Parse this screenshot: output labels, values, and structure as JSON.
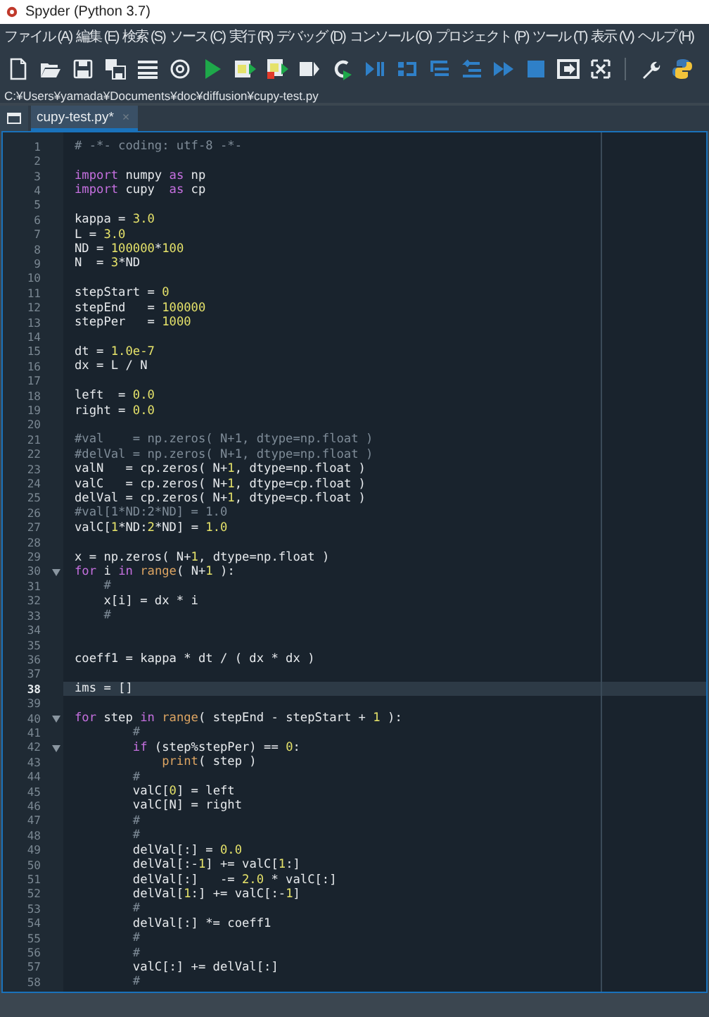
{
  "window": {
    "title": "Spyder (Python 3.7)"
  },
  "menu": [
    "ファイル (A)",
    "編集 (E)",
    "検索 (S)",
    "ソース (C)",
    "実行 (R)",
    "デバッグ (D)",
    "コンソール (O)",
    "プロジェクト (P)",
    "ツール (T)",
    "表示 (V)",
    "ヘルプ (H)"
  ],
  "path": "C:¥Users¥yamada¥Documents¥doc¥diffusion¥cupy-test.py",
  "tabs": [
    {
      "label": "cupy-test.py*",
      "selected": true,
      "close": "×"
    }
  ],
  "editor": {
    "lines": [
      {
        "number": "1",
        "fold": false,
        "current": false,
        "tokens": [
          {
            "text": "# -*- coding: utf-8 -*-",
            "kind": "comment"
          }
        ]
      },
      {
        "number": "2",
        "fold": false,
        "current": false
      },
      {
        "number": "3",
        "fold": false,
        "current": false,
        "tokens": [
          {
            "text": "import",
            "kind": "keyword"
          },
          {
            "text": " numpy ",
            "kind": "plain"
          },
          {
            "text": "as",
            "kind": "keyword"
          },
          {
            "text": " np",
            "kind": "plain"
          }
        ]
      },
      {
        "number": "4",
        "fold": false,
        "current": false,
        "tokens": [
          {
            "text": "import",
            "kind": "keyword"
          },
          {
            "text": " cupy  ",
            "kind": "plain"
          },
          {
            "text": "as",
            "kind": "keyword"
          },
          {
            "text": " cp",
            "kind": "plain"
          }
        ]
      },
      {
        "number": "5",
        "fold": false,
        "current": false
      },
      {
        "number": "6",
        "fold": false,
        "current": false,
        "tokens": [
          {
            "text": "kappa = ",
            "kind": "plain"
          },
          {
            "text": "3.0",
            "kind": "number"
          }
        ]
      },
      {
        "number": "7",
        "fold": false,
        "current": false,
        "tokens": [
          {
            "text": "L = ",
            "kind": "plain"
          },
          {
            "text": "3.0",
            "kind": "number"
          }
        ]
      },
      {
        "number": "8",
        "fold": false,
        "current": false,
        "tokens": [
          {
            "text": "ND = ",
            "kind": "plain"
          },
          {
            "text": "100000",
            "kind": "number"
          },
          {
            "text": "*",
            "kind": "plain"
          },
          {
            "text": "100",
            "kind": "number"
          }
        ]
      },
      {
        "number": "9",
        "fold": false,
        "current": false,
        "tokens": [
          {
            "text": "N  = ",
            "kind": "plain"
          },
          {
            "text": "3",
            "kind": "number"
          },
          {
            "text": "*ND",
            "kind": "plain"
          }
        ]
      },
      {
        "number": "10",
        "fold": false,
        "current": false
      },
      {
        "number": "11",
        "fold": false,
        "current": false,
        "tokens": [
          {
            "text": "stepStart = ",
            "kind": "plain"
          },
          {
            "text": "0",
            "kind": "number"
          }
        ]
      },
      {
        "number": "12",
        "fold": false,
        "current": false,
        "tokens": [
          {
            "text": "stepEnd   = ",
            "kind": "plain"
          },
          {
            "text": "100000",
            "kind": "number"
          }
        ]
      },
      {
        "number": "13",
        "fold": false,
        "current": false,
        "tokens": [
          {
            "text": "stepPer   = ",
            "kind": "plain"
          },
          {
            "text": "1000",
            "kind": "number"
          }
        ]
      },
      {
        "number": "14",
        "fold": false,
        "current": false
      },
      {
        "number": "15",
        "fold": false,
        "current": false,
        "tokens": [
          {
            "text": "dt = ",
            "kind": "plain"
          },
          {
            "text": "1.0e-7",
            "kind": "number"
          }
        ]
      },
      {
        "number": "16",
        "fold": false,
        "current": false,
        "tokens": [
          {
            "text": "dx = L / N",
            "kind": "plain"
          }
        ]
      },
      {
        "number": "17",
        "fold": false,
        "current": false
      },
      {
        "number": "18",
        "fold": false,
        "current": false,
        "tokens": [
          {
            "text": "left  = ",
            "kind": "plain"
          },
          {
            "text": "0.0",
            "kind": "number"
          }
        ]
      },
      {
        "number": "19",
        "fold": false,
        "current": false,
        "tokens": [
          {
            "text": "right = ",
            "kind": "plain"
          },
          {
            "text": "0.0",
            "kind": "number"
          }
        ]
      },
      {
        "number": "20",
        "fold": false,
        "current": false
      },
      {
        "number": "21",
        "fold": false,
        "current": false,
        "tokens": [
          {
            "text": "#val    = np.zeros( N+1, dtype=np.float )",
            "kind": "comment"
          }
        ]
      },
      {
        "number": "22",
        "fold": false,
        "current": false,
        "tokens": [
          {
            "text": "#delVal = np.zeros( N+1, dtype=np.float )",
            "kind": "comment"
          }
        ]
      },
      {
        "number": "23",
        "fold": false,
        "current": false,
        "tokens": [
          {
            "text": "valN   = cp.zeros( N+",
            "kind": "plain"
          },
          {
            "text": "1",
            "kind": "number"
          },
          {
            "text": ", dtype=np.float )",
            "kind": "plain"
          }
        ]
      },
      {
        "number": "24",
        "fold": false,
        "current": false,
        "tokens": [
          {
            "text": "valC   = cp.zeros( N+",
            "kind": "plain"
          },
          {
            "text": "1",
            "kind": "number"
          },
          {
            "text": ", dtype=cp.float )",
            "kind": "plain"
          }
        ]
      },
      {
        "number": "25",
        "fold": false,
        "current": false,
        "tokens": [
          {
            "text": "delVal = cp.zeros( N+",
            "kind": "plain"
          },
          {
            "text": "1",
            "kind": "number"
          },
          {
            "text": ", dtype=cp.float )",
            "kind": "plain"
          }
        ]
      },
      {
        "number": "26",
        "fold": false,
        "current": false,
        "tokens": [
          {
            "text": "#val[1*ND:2*ND] = 1.0",
            "kind": "comment"
          }
        ]
      },
      {
        "number": "27",
        "fold": false,
        "current": false,
        "tokens": [
          {
            "text": "valC[",
            "kind": "plain"
          },
          {
            "text": "1",
            "kind": "number"
          },
          {
            "text": "*ND:",
            "kind": "plain"
          },
          {
            "text": "2",
            "kind": "number"
          },
          {
            "text": "*ND] = ",
            "kind": "plain"
          },
          {
            "text": "1.0",
            "kind": "number"
          }
        ]
      },
      {
        "number": "28",
        "fold": false,
        "current": false
      },
      {
        "number": "29",
        "fold": false,
        "current": false,
        "tokens": [
          {
            "text": "x = np.zeros( N+",
            "kind": "plain"
          },
          {
            "text": "1",
            "kind": "number"
          },
          {
            "text": ", dtype=np.float )",
            "kind": "plain"
          }
        ]
      },
      {
        "number": "30",
        "fold": true,
        "current": false,
        "tokens": [
          {
            "text": "for",
            "kind": "keyword"
          },
          {
            "text": " i ",
            "kind": "plain"
          },
          {
            "text": "in",
            "kind": "keyword"
          },
          {
            "text": " range",
            "kind": "builtin"
          },
          {
            "text": "( N+",
            "kind": "plain"
          },
          {
            "text": "1",
            "kind": "number"
          },
          {
            "text": " ):",
            "kind": "plain"
          }
        ]
      },
      {
        "number": "31",
        "fold": false,
        "current": false,
        "tokens": [
          {
            "text": "    #",
            "kind": "comment"
          }
        ]
      },
      {
        "number": "32",
        "fold": false,
        "current": false,
        "tokens": [
          {
            "text": "    x[i] = dx * i",
            "kind": "plain"
          }
        ]
      },
      {
        "number": "33",
        "fold": false,
        "current": false,
        "tokens": [
          {
            "text": "    #",
            "kind": "comment"
          }
        ]
      },
      {
        "number": "34",
        "fold": false,
        "current": false
      },
      {
        "number": "35",
        "fold": false,
        "current": false
      },
      {
        "number": "36",
        "fold": false,
        "current": false,
        "tokens": [
          {
            "text": "coeff1 = kappa * dt / ( dx * dx )",
            "kind": "plain"
          }
        ]
      },
      {
        "number": "37",
        "fold": false,
        "current": false
      },
      {
        "number": "38",
        "fold": false,
        "current": true,
        "tokens": [
          {
            "text": "ims = []",
            "kind": "plain"
          }
        ]
      },
      {
        "number": "39",
        "fold": false,
        "current": false
      },
      {
        "number": "40",
        "fold": true,
        "current": false,
        "tokens": [
          {
            "text": "for",
            "kind": "keyword"
          },
          {
            "text": " step ",
            "kind": "plain"
          },
          {
            "text": "in",
            "kind": "keyword"
          },
          {
            "text": " range",
            "kind": "builtin"
          },
          {
            "text": "( stepEnd - stepStart + ",
            "kind": "plain"
          },
          {
            "text": "1",
            "kind": "number"
          },
          {
            "text": " ):",
            "kind": "plain"
          }
        ]
      },
      {
        "number": "41",
        "fold": false,
        "current": false,
        "tokens": [
          {
            "text": "        #",
            "kind": "comment"
          }
        ]
      },
      {
        "number": "42",
        "fold": true,
        "current": false,
        "tokens": [
          {
            "text": "        if",
            "kind": "keyword"
          },
          {
            "text": " (step%stepPer) == ",
            "kind": "plain"
          },
          {
            "text": "0",
            "kind": "number"
          },
          {
            "text": ":",
            "kind": "plain"
          }
        ]
      },
      {
        "number": "43",
        "fold": false,
        "current": false,
        "tokens": [
          {
            "text": "            print",
            "kind": "builtin"
          },
          {
            "text": "( step )",
            "kind": "plain"
          }
        ]
      },
      {
        "number": "44",
        "fold": false,
        "current": false,
        "tokens": [
          {
            "text": "        #",
            "kind": "comment"
          }
        ]
      },
      {
        "number": "45",
        "fold": false,
        "current": false,
        "tokens": [
          {
            "text": "        valC[",
            "kind": "plain"
          },
          {
            "text": "0",
            "kind": "number"
          },
          {
            "text": "] = left",
            "kind": "plain"
          }
        ]
      },
      {
        "number": "46",
        "fold": false,
        "current": false,
        "tokens": [
          {
            "text": "        valC[N] = right",
            "kind": "plain"
          }
        ]
      },
      {
        "number": "47",
        "fold": false,
        "current": false,
        "tokens": [
          {
            "text": "        #",
            "kind": "comment"
          }
        ]
      },
      {
        "number": "48",
        "fold": false,
        "current": false,
        "tokens": [
          {
            "text": "        #",
            "kind": "comment"
          }
        ]
      },
      {
        "number": "49",
        "fold": false,
        "current": false,
        "tokens": [
          {
            "text": "        delVal[:] = ",
            "kind": "plain"
          },
          {
            "text": "0.0",
            "kind": "number"
          }
        ]
      },
      {
        "number": "50",
        "fold": false,
        "current": false,
        "tokens": [
          {
            "text": "        delVal[:-",
            "kind": "plain"
          },
          {
            "text": "1",
            "kind": "number"
          },
          {
            "text": "] += valC[",
            "kind": "plain"
          },
          {
            "text": "1",
            "kind": "number"
          },
          {
            "text": ":]",
            "kind": "plain"
          }
        ]
      },
      {
        "number": "51",
        "fold": false,
        "current": false,
        "tokens": [
          {
            "text": "        delVal[:]   -= ",
            "kind": "plain"
          },
          {
            "text": "2.0",
            "kind": "number"
          },
          {
            "text": " * valC[:]",
            "kind": "plain"
          }
        ]
      },
      {
        "number": "52",
        "fold": false,
        "current": false,
        "tokens": [
          {
            "text": "        delVal[",
            "kind": "plain"
          },
          {
            "text": "1",
            "kind": "number"
          },
          {
            "text": ":] += valC[:-",
            "kind": "plain"
          },
          {
            "text": "1",
            "kind": "number"
          },
          {
            "text": "]",
            "kind": "plain"
          }
        ]
      },
      {
        "number": "53",
        "fold": false,
        "current": false,
        "tokens": [
          {
            "text": "        #",
            "kind": "comment"
          }
        ]
      },
      {
        "number": "54",
        "fold": false,
        "current": false,
        "tokens": [
          {
            "text": "        delVal[:] *= coeff1",
            "kind": "plain"
          }
        ]
      },
      {
        "number": "55",
        "fold": false,
        "current": false,
        "tokens": [
          {
            "text": "        #",
            "kind": "comment"
          }
        ]
      },
      {
        "number": "56",
        "fold": false,
        "current": false,
        "tokens": [
          {
            "text": "        #",
            "kind": "comment"
          }
        ]
      },
      {
        "number": "57",
        "fold": false,
        "current": false,
        "tokens": [
          {
            "text": "        valC[:] += delVal[:]",
            "kind": "plain"
          }
        ]
      },
      {
        "number": "58",
        "fold": false,
        "current": false,
        "tokens": [
          {
            "text": "        #",
            "kind": "comment"
          }
        ]
      }
    ]
  }
}
